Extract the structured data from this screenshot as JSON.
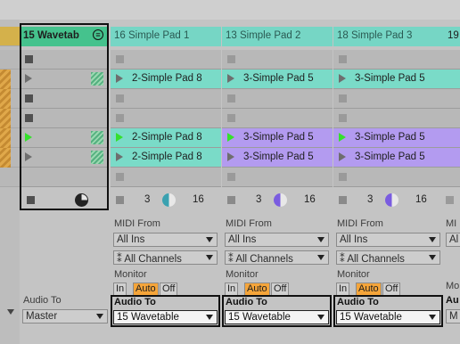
{
  "tracks": [
    {
      "header": "15 Wavetab",
      "header_bg": "#45c28d",
      "slot_bg": "#b8b8b8",
      "slots": [
        {
          "kind": "stop"
        },
        {
          "kind": "play"
        },
        {
          "kind": "stop"
        },
        {
          "kind": "stop"
        },
        {
          "kind": "play-active"
        },
        {
          "kind": "play"
        },
        {
          "kind": "empty"
        }
      ],
      "audio_to_label": "Audio To",
      "audio_to_value": "Master"
    },
    {
      "header": "16 Simple Pad 1",
      "header_bg": "#76d6c5",
      "clip_color": "#7adbc8",
      "clips": [
        "2-Simple Pad 8",
        "2-Simple Pad 8",
        "2-Simple Pad 8"
      ],
      "status_num": "3",
      "status_num2": "16",
      "midi_from_label": "MIDI From",
      "midi_from_value": "All Ins",
      "channels_value": "All Channels",
      "monitor_label": "Monitor",
      "monitor_buttons": [
        "In",
        "Auto",
        "Off"
      ],
      "audio_to_label": "Audio To",
      "audio_to_value": "15 Wavetable"
    },
    {
      "header": "13 Simple Pad 2",
      "header_bg": "#76d6c5",
      "clip_color": "#b39bf0",
      "clip_color_first": "#7adbc8",
      "clips": [
        "3-Simple Pad 5",
        "3-Simple Pad 5",
        "3-Simple Pad 5"
      ],
      "status_num": "3",
      "status_num2": "16",
      "midi_from_label": "MIDI From",
      "midi_from_value": "All Ins",
      "channels_value": "All Channels",
      "monitor_label": "Monitor",
      "monitor_buttons": [
        "In",
        "Auto",
        "Off"
      ],
      "audio_to_label": "Audio To",
      "audio_to_value": "15 Wavetable"
    },
    {
      "header": "18 Simple Pad 3",
      "header_bg": "#76d6c5",
      "clip_color": "#b39bf0",
      "clip_color_first": "#7adbc8",
      "clips": [
        "3-Simple Pad 5",
        "3-Simple Pad 5",
        "3-Simple Pad 5"
      ],
      "status_num": "3",
      "status_num2": "16",
      "midi_from_label": "MIDI From",
      "midi_from_value": "All Ins",
      "channels_value": "All Channels",
      "monitor_label": "Monitor",
      "monitor_buttons": [
        "In",
        "Auto",
        "Off"
      ],
      "audio_to_label": "Audio To",
      "audio_to_value": "15 Wavetable"
    },
    {
      "header": "19",
      "status_partial_io": [
        "MI",
        "Al",
        "Mo",
        "Au",
        "M"
      ]
    }
  ],
  "colors": {
    "accent_green": "#35e02c",
    "monitor_auto": "#f5a53a"
  }
}
